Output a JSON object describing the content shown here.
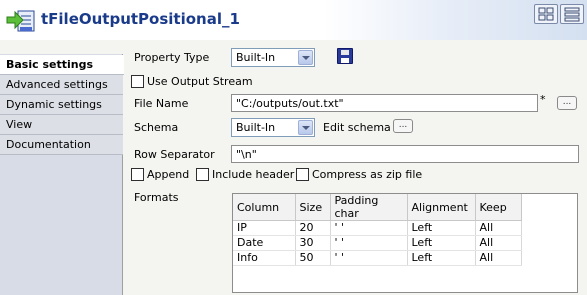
{
  "component": {
    "title": "tFileOutputPositional_1",
    "icon": "file-output-positional-icon"
  },
  "sidebar": {
    "tabs": [
      {
        "label": "Basic settings",
        "active": true
      },
      {
        "label": "Advanced settings",
        "active": false
      },
      {
        "label": "Dynamic settings",
        "active": false
      },
      {
        "label": "View",
        "active": false
      },
      {
        "label": "Documentation",
        "active": false
      }
    ]
  },
  "form": {
    "property_type_label": "Property Type",
    "property_type_value": "Built-In",
    "use_output_stream_label": "Use Output Stream",
    "file_name_label": "File Name",
    "file_name_value": "\"C:/outputs/out.txt\"",
    "file_name_marker": "*",
    "schema_label": "Schema",
    "schema_value": "Built-In",
    "edit_schema_label": "Edit schema",
    "row_separator_label": "Row Separator",
    "row_separator_value": "\"\\n\"",
    "append_label": "Append",
    "include_header_label": "Include header",
    "compress_label": "Compress as zip file",
    "formats_label": "Formats",
    "dots_label": "..."
  },
  "formats_table": {
    "headers": [
      "Column",
      "Size",
      "Padding char",
      "Alignment",
      "Keep"
    ],
    "rows": [
      [
        "IP",
        "20",
        "' '",
        "Left",
        "All"
      ],
      [
        "Date",
        "30",
        "' '",
        "Left",
        "All"
      ],
      [
        "Info",
        "50",
        "' '",
        "Left",
        "All"
      ]
    ]
  }
}
